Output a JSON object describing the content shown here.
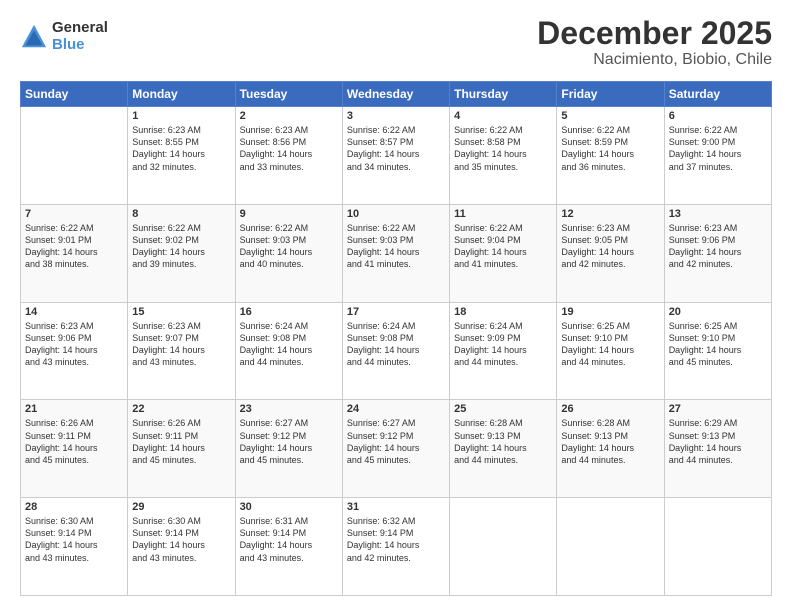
{
  "logo": {
    "general": "General",
    "blue": "Blue"
  },
  "title": "December 2025",
  "subtitle": "Nacimiento, Biobio, Chile",
  "days_of_week": [
    "Sunday",
    "Monday",
    "Tuesday",
    "Wednesday",
    "Thursday",
    "Friday",
    "Saturday"
  ],
  "weeks": [
    [
      {
        "day": "",
        "info": ""
      },
      {
        "day": "1",
        "info": "Sunrise: 6:23 AM\nSunset: 8:55 PM\nDaylight: 14 hours\nand 32 minutes."
      },
      {
        "day": "2",
        "info": "Sunrise: 6:23 AM\nSunset: 8:56 PM\nDaylight: 14 hours\nand 33 minutes."
      },
      {
        "day": "3",
        "info": "Sunrise: 6:22 AM\nSunset: 8:57 PM\nDaylight: 14 hours\nand 34 minutes."
      },
      {
        "day": "4",
        "info": "Sunrise: 6:22 AM\nSunset: 8:58 PM\nDaylight: 14 hours\nand 35 minutes."
      },
      {
        "day": "5",
        "info": "Sunrise: 6:22 AM\nSunset: 8:59 PM\nDaylight: 14 hours\nand 36 minutes."
      },
      {
        "day": "6",
        "info": "Sunrise: 6:22 AM\nSunset: 9:00 PM\nDaylight: 14 hours\nand 37 minutes."
      }
    ],
    [
      {
        "day": "7",
        "info": "Sunrise: 6:22 AM\nSunset: 9:01 PM\nDaylight: 14 hours\nand 38 minutes."
      },
      {
        "day": "8",
        "info": "Sunrise: 6:22 AM\nSunset: 9:02 PM\nDaylight: 14 hours\nand 39 minutes."
      },
      {
        "day": "9",
        "info": "Sunrise: 6:22 AM\nSunset: 9:03 PM\nDaylight: 14 hours\nand 40 minutes."
      },
      {
        "day": "10",
        "info": "Sunrise: 6:22 AM\nSunset: 9:03 PM\nDaylight: 14 hours\nand 41 minutes."
      },
      {
        "day": "11",
        "info": "Sunrise: 6:22 AM\nSunset: 9:04 PM\nDaylight: 14 hours\nand 41 minutes."
      },
      {
        "day": "12",
        "info": "Sunrise: 6:23 AM\nSunset: 9:05 PM\nDaylight: 14 hours\nand 42 minutes."
      },
      {
        "day": "13",
        "info": "Sunrise: 6:23 AM\nSunset: 9:06 PM\nDaylight: 14 hours\nand 42 minutes."
      }
    ],
    [
      {
        "day": "14",
        "info": "Sunrise: 6:23 AM\nSunset: 9:06 PM\nDaylight: 14 hours\nand 43 minutes."
      },
      {
        "day": "15",
        "info": "Sunrise: 6:23 AM\nSunset: 9:07 PM\nDaylight: 14 hours\nand 43 minutes."
      },
      {
        "day": "16",
        "info": "Sunrise: 6:24 AM\nSunset: 9:08 PM\nDaylight: 14 hours\nand 44 minutes."
      },
      {
        "day": "17",
        "info": "Sunrise: 6:24 AM\nSunset: 9:08 PM\nDaylight: 14 hours\nand 44 minutes."
      },
      {
        "day": "18",
        "info": "Sunrise: 6:24 AM\nSunset: 9:09 PM\nDaylight: 14 hours\nand 44 minutes."
      },
      {
        "day": "19",
        "info": "Sunrise: 6:25 AM\nSunset: 9:10 PM\nDaylight: 14 hours\nand 44 minutes."
      },
      {
        "day": "20",
        "info": "Sunrise: 6:25 AM\nSunset: 9:10 PM\nDaylight: 14 hours\nand 45 minutes."
      }
    ],
    [
      {
        "day": "21",
        "info": "Sunrise: 6:26 AM\nSunset: 9:11 PM\nDaylight: 14 hours\nand 45 minutes."
      },
      {
        "day": "22",
        "info": "Sunrise: 6:26 AM\nSunset: 9:11 PM\nDaylight: 14 hours\nand 45 minutes."
      },
      {
        "day": "23",
        "info": "Sunrise: 6:27 AM\nSunset: 9:12 PM\nDaylight: 14 hours\nand 45 minutes."
      },
      {
        "day": "24",
        "info": "Sunrise: 6:27 AM\nSunset: 9:12 PM\nDaylight: 14 hours\nand 45 minutes."
      },
      {
        "day": "25",
        "info": "Sunrise: 6:28 AM\nSunset: 9:13 PM\nDaylight: 14 hours\nand 44 minutes."
      },
      {
        "day": "26",
        "info": "Sunrise: 6:28 AM\nSunset: 9:13 PM\nDaylight: 14 hours\nand 44 minutes."
      },
      {
        "day": "27",
        "info": "Sunrise: 6:29 AM\nSunset: 9:13 PM\nDaylight: 14 hours\nand 44 minutes."
      }
    ],
    [
      {
        "day": "28",
        "info": "Sunrise: 6:30 AM\nSunset: 9:14 PM\nDaylight: 14 hours\nand 43 minutes."
      },
      {
        "day": "29",
        "info": "Sunrise: 6:30 AM\nSunset: 9:14 PM\nDaylight: 14 hours\nand 43 minutes."
      },
      {
        "day": "30",
        "info": "Sunrise: 6:31 AM\nSunset: 9:14 PM\nDaylight: 14 hours\nand 43 minutes."
      },
      {
        "day": "31",
        "info": "Sunrise: 6:32 AM\nSunset: 9:14 PM\nDaylight: 14 hours\nand 42 minutes."
      },
      {
        "day": "",
        "info": ""
      },
      {
        "day": "",
        "info": ""
      },
      {
        "day": "",
        "info": ""
      }
    ]
  ]
}
